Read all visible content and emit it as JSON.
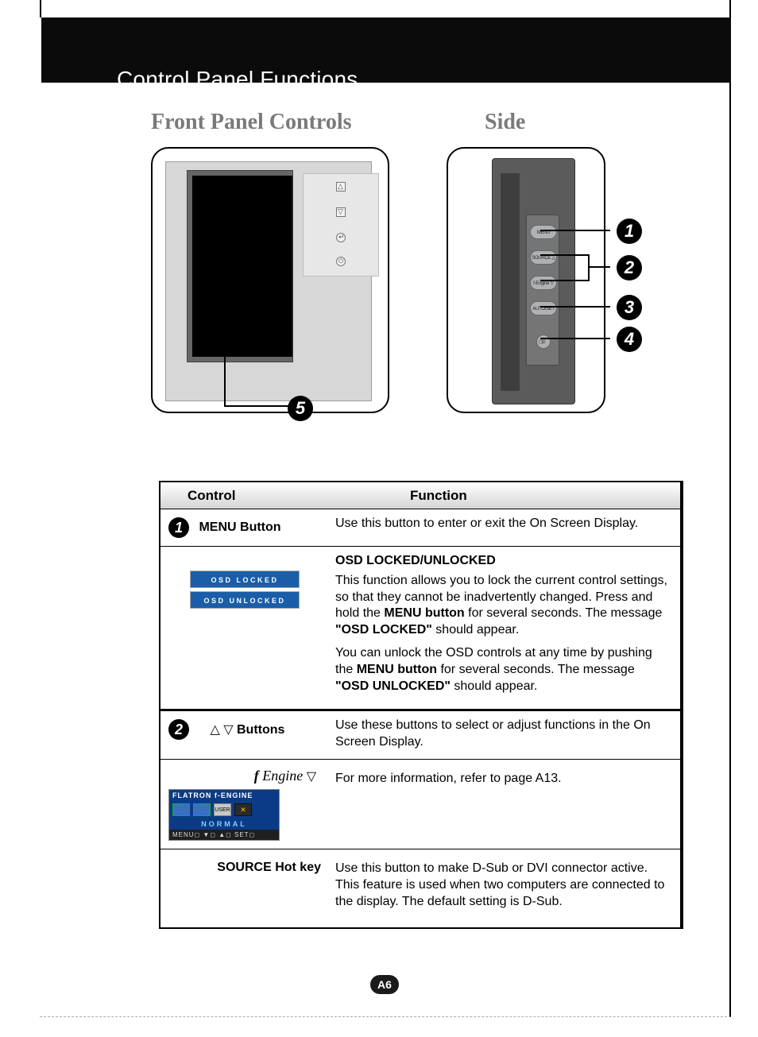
{
  "header": {
    "title": "Control Panel Functions"
  },
  "subheads": {
    "front": "Front Panel Controls",
    "side": "Side"
  },
  "front_strip": {
    "up": "△",
    "down": "▽",
    "enter": "↵",
    "power": "⏻"
  },
  "callouts": {
    "n1": "1",
    "n2": "2",
    "n3": "3",
    "n4": "4",
    "n5": "5"
  },
  "side_buttons": {
    "b1": "MENU",
    "b2": "SOURCE △",
    "b3": "f-Engine ▽",
    "b4": "AUTO/SET",
    "b5": "⏻"
  },
  "table": {
    "head": {
      "control": "Control",
      "function": "Function"
    },
    "row1": {
      "label": "MENU Button",
      "desc": "Use this button to enter or exit the On Screen Display.",
      "osd_locked_badge": "OSD LOCKED",
      "osd_unlocked_badge": "OSD UNLOCKED",
      "subhead": "OSD LOCKED/UNLOCKED",
      "p1a": "This function allows you to lock the current control settings, so that they cannot be inadvertently changed. Press and hold the ",
      "p1b": "MENU button",
      "p1c": " for several seconds. The message ",
      "p1d": "\"OSD LOCKED\"",
      "p1e": " should appear.",
      "p2a": "You can unlock the OSD controls at any time by pushing the ",
      "p2b": "MENU button",
      "p2c": " for several seconds. The message ",
      "p2d": "\"OSD UNLOCKED\"",
      "p2e": " should appear."
    },
    "row2": {
      "tri_up": "△",
      "tri_down": "▽",
      "label": "Buttons",
      "desc": "Use these buttons to select or adjust functions in the On Screen Display.",
      "fengine_label_a": "Engine",
      "fengine_tri": "▽",
      "fengine_desc": "For more information, refer to page A13.",
      "fe_box": {
        "hdr": "FLATRON  f-ENGINE",
        "user": "USER",
        "x": "✕",
        "normal": "NORMAL",
        "ftr": "MENU◻  ▼◻  ▲◻  SET◻"
      }
    },
    "row3": {
      "label": "SOURCE Hot key",
      "desc": "Use this button to make D-Sub or DVI connector active. This feature is used when two computers are connected to the display. The default setting is D-Sub."
    }
  },
  "page_number": "A6"
}
